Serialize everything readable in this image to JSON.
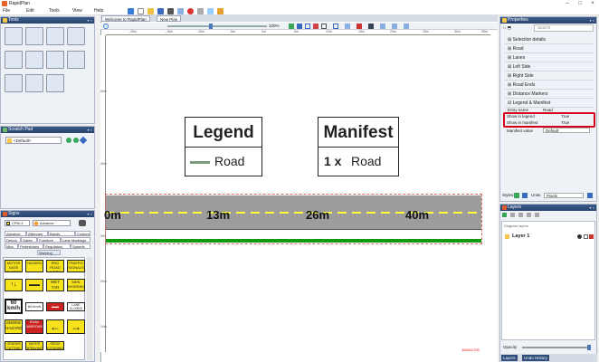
{
  "window": {
    "title": "RapidPlan"
  },
  "menu": [
    "File",
    "Edit",
    "Tools",
    "View",
    "Help"
  ],
  "tools_panel": {
    "title": "Tools"
  },
  "scratch_panel": {
    "title": "Scratch Pad",
    "dropdown_value": "<Default>"
  },
  "signs_panel": {
    "title": "Signs",
    "category_a": "CPM-3",
    "category_b": "Advance",
    "tabs_row1": [
      "Advance",
      "Aftercare",
      "Bands Markers",
      "Custom"
    ],
    "tabs_row2": [
      "Detour",
      "Gates",
      "Furniture",
      "Lane Markings"
    ],
    "tabs_row3": [
      "Misc",
      "Pedestrians",
      "Regulatory",
      "Speeds"
    ],
    "tab_warning": "Warning",
    "signs": [
      {
        "text": "MOTOR GATE CLOSED"
      },
      {
        "text": "HAZARD"
      },
      {
        "text": "END ROAD WORK"
      },
      {
        "text": "TRAFFIC SIGNALS"
      },
      {
        "text": "↑↓"
      },
      {
        "text": "▬▬"
      },
      {
        "text": "WET TAR"
      },
      {
        "text": "MEN WORKING"
      },
      {
        "text": "60 km/h"
      },
      {
        "text": "60 km/h"
      },
      {
        "text": "▬▬"
      },
      {
        "text": "LANE CLOSED"
      },
      {
        "text": "SMOKE HAZARD"
      },
      {
        "text": "ROAD NARROWS"
      },
      {
        "text": "←"
      },
      {
        "text": "→"
      },
      {
        "text": "GRADER CUTTING"
      },
      {
        "text": "WATER SPRAYING"
      },
      {
        "text": "RIDGE CLEANING"
      }
    ]
  },
  "document_tabs": [
    {
      "label": "Welcome to RapidPlan"
    },
    {
      "label": "New Plan"
    }
  ],
  "toolbar": {
    "zoom": "100%"
  },
  "rulers": {
    "h": [
      "-25m",
      "-15m",
      "-10m",
      "-5m",
      "0m",
      "5m",
      "10m",
      "15m",
      "20m",
      "25m",
      "30m",
      "35m"
    ],
    "v": [
      "50m",
      "40m",
      "30m",
      "20m",
      "10m"
    ]
  },
  "legend": {
    "title": "Legend",
    "item": "Road"
  },
  "manifest": {
    "title": "Manifest",
    "qty": "1 x",
    "item": "Road"
  },
  "road_labels": [
    "0m",
    "13m",
    "26m",
    "40m"
  ],
  "scale_label": "1500x1700",
  "properties": {
    "title": "Properties",
    "search_placeholder": "Search",
    "sections": [
      "Selection details",
      "Road",
      "Lanes",
      "Left Side",
      "Right Side",
      "Road Ends",
      "Distance Markers",
      "Legend & Manifest"
    ],
    "entry_name_label": "Entry name",
    "entry_name_value": "Road",
    "show_legend_label": "Show in legend",
    "show_legend_value": "True",
    "show_manifest_label": "Show in manifest",
    "show_manifest_value": "True",
    "manifest_value_label": "Manifest value",
    "manifest_value_value": "Default",
    "styles_label": "Styles:",
    "units_label": "Units",
    "units_value": "Pixels"
  },
  "layers": {
    "title": "Layers",
    "diagram_label": "Diagram layers",
    "layer1": "Layer 1",
    "opacity_label": "Opacity",
    "footer_tabs": [
      "Layers",
      "Undo History"
    ]
  },
  "colors": {
    "highlight": "#d6001c",
    "road": "#9c9c9c",
    "lane_mark": "#ffff3b",
    "grass": "#119911",
    "panel_head": "#2f4e7c"
  }
}
